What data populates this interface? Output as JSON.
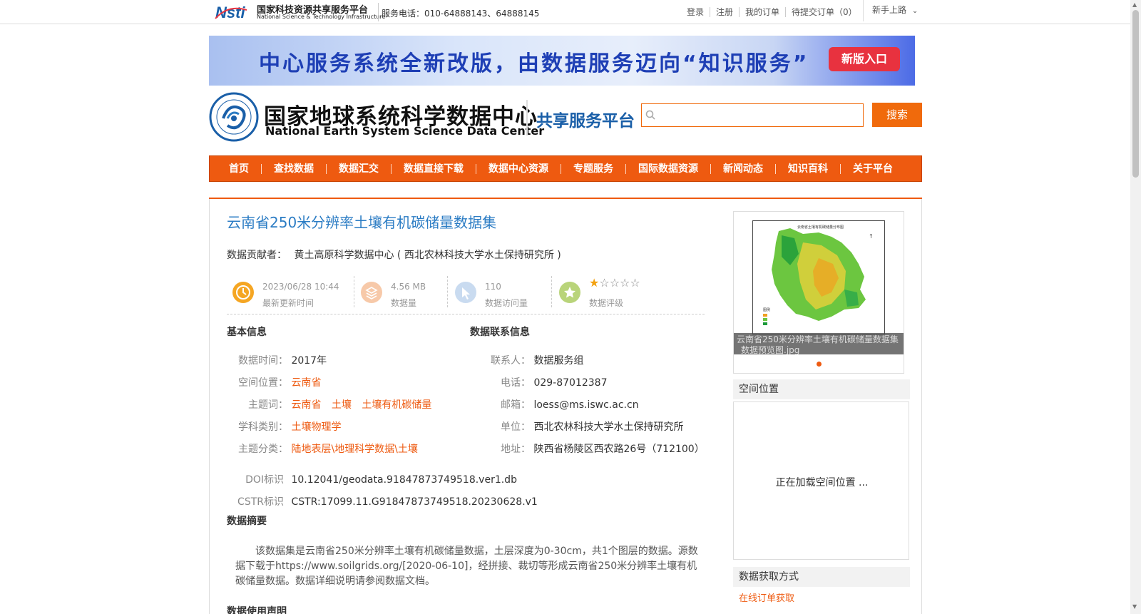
{
  "topbar": {
    "logo_cn": "国家科技资源共享服务平台",
    "logo_en": "National Science & Technology Infrastructure",
    "logo_mark": "Nsti",
    "phone": "服务电话：010-64888143、64888145",
    "links": [
      "登录",
      "注册",
      "我的订单",
      "待提交订单（0）"
    ],
    "newbie": "新手上路"
  },
  "banner": {
    "text": "中心服务系统全新改版，由数据服务迈向“知识服务”",
    "button": "新版入口"
  },
  "header": {
    "center_cn": "国家地球系统科学数据中心",
    "center_en": "National Earth System Science Data Center",
    "platform": "共享服务平台",
    "search_placeholder": "",
    "search_button": "搜索"
  },
  "nav": [
    "首页",
    "查找数据",
    "数据汇交",
    "数据直接下载",
    "数据中心资源",
    "专题服务",
    "国际数据资源",
    "新闻动态",
    "知识百科",
    "关于平台"
  ],
  "dataset": {
    "title": "云南省250米分辨率土壤有机碳储量数据集",
    "contributor_label": "数据贡献者：",
    "contributor": "黄土高原科学数据中心 ( 西北农林科技大学水土保持研究所 )",
    "stats": {
      "updated": "2023/06/28 10:44",
      "updated_label": "最新更新时间",
      "size": "4.56 MB",
      "size_label": "数据量",
      "visits": "110",
      "visits_label": "数据访问量",
      "rating": 1,
      "rating_max": 5,
      "rating_label": "数据评级"
    },
    "basic_title": "基本信息",
    "contact_title": "数据联系信息",
    "basic": {
      "time_label": "数据时间：",
      "time": "2017年",
      "space_label": "空间位置：",
      "space": "云南省",
      "keywords_label": "主题词：",
      "keywords": [
        "云南省",
        "土壤",
        "土壤有机碳储量"
      ],
      "discipline_label": "学科类别：",
      "discipline": "土壤物理学",
      "category_label": "主题分类：",
      "category": "陆地表层\\地理科学数据\\土壤"
    },
    "contact": {
      "person_label": "联系人：",
      "person": "数据服务组",
      "phone_label": "电话：",
      "phone": "029-87012387",
      "email_label": "邮箱：",
      "email": "loess@ms.iswc.ac.cn",
      "unit_label": "单位：",
      "unit": "西北农林科技大学水土保持研究所",
      "address_label": "地址：",
      "address": "陕西省杨陵区西农路26号（712100）"
    },
    "doi_label": "DOI标识",
    "doi": "10.12041/geodata.91847873749518.ver1.db",
    "cstr_label": "CSTR标识",
    "cstr": "CSTR:17099.11.G91847873749518.20230628.v1",
    "summary_title": "数据摘要",
    "summary": "该数据集是云南省250米分辨率土壤有机碳储量数据，土层深度为0-30cm，共1个图层的数据。源数据下载于https://www.soilgrids.org/[2020-06-10]，经拼接、裁切等形成云南省250米分辨率土壤有机碳储量数据。数据详细说明请参阅数据文档。",
    "usage_title": "数据使用声明"
  },
  "sidebar": {
    "preview_caption": "云南省250米分辨率土壤有机碳储量数据集_数据预览图.jpg",
    "map_title": "云南省土壤有机碳储量分布图",
    "map_legend": "图例",
    "space_title": "空间位置",
    "space_loading": "正在加载空间位置 ...",
    "acquire_title": "数据获取方式",
    "acquire_link": "在线订单获取"
  },
  "colors": {
    "accent": "#ee5a10",
    "title_blue": "#2b7cc4",
    "star": "#f3a10f"
  }
}
